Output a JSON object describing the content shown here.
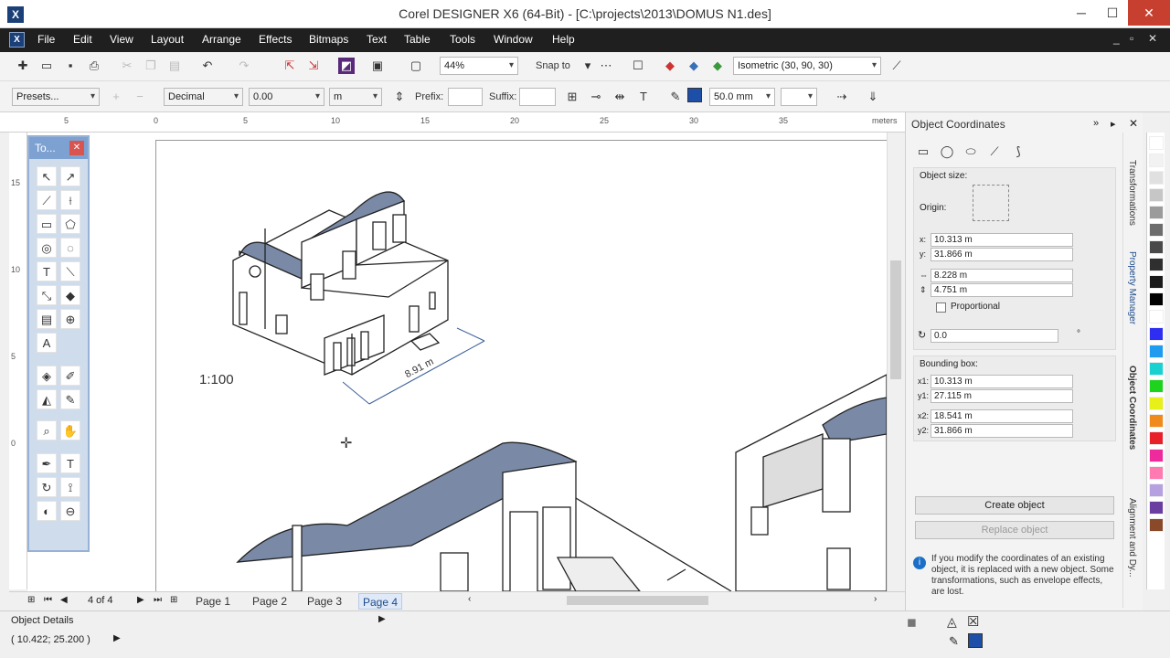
{
  "window": {
    "title": "Corel DESIGNER X6 (64-Bit) - [C:\\projects\\2013\\DOMUS N1.des]",
    "app_icon": "X",
    "minimize": "─",
    "maximize": "☐",
    "close": "✕"
  },
  "menu": {
    "items": [
      "File",
      "Edit",
      "View",
      "Layout",
      "Arrange",
      "Effects",
      "Bitmaps",
      "Text",
      "Table",
      "Tools",
      "Window",
      "Help"
    ],
    "right_controls": [
      "_",
      "▫",
      "✕"
    ]
  },
  "toolbar1": {
    "zoom": "44%",
    "snap_to": "Snap to",
    "view": "Isometric (30, 90, 30)"
  },
  "toolbar2": {
    "presets": "Presets...",
    "units_style": "Decimal",
    "precision": "0.00",
    "units": "m",
    "prefix_label": "Prefix:",
    "prefix_value": "",
    "suffix_label": "Suffix:",
    "suffix_value": "",
    "outline_width": "50.0 mm"
  },
  "ruler": {
    "h_ticks": [
      "5",
      "0",
      "5",
      "10",
      "15",
      "20",
      "25",
      "30",
      "35"
    ],
    "unit": "meters",
    "v_ticks": [
      "15",
      "10",
      "5",
      "0"
    ]
  },
  "toolbox": {
    "title": "To...",
    "close": "✕"
  },
  "drawing": {
    "scale_label": "1:100",
    "dimension_label": "8.91 m"
  },
  "pagebar": {
    "page_count": "4 of 4",
    "tabs": [
      "Page 1",
      "Page 2",
      "Page 3",
      "Page 4"
    ],
    "active_tab": "Page 4"
  },
  "status": {
    "object_details": "Object Details",
    "coords": "( 10.422; 25.200 )"
  },
  "docker": {
    "title": "Object Coordinates",
    "object_size_label": "Object size:",
    "origin_label": "Origin:",
    "x": "10.313 m",
    "y": "31.866 m",
    "width": "8.228 m",
    "height": "4.751 m",
    "proportional_label": "Proportional",
    "rotation": "0.0",
    "rotation_unit": "°",
    "bounding_box_label": "Bounding box:",
    "x1": "10.313 m",
    "y1": "27.115 m",
    "x2": "18.541 m",
    "y2": "31.866 m",
    "create_button": "Create object",
    "replace_button": "Replace object",
    "info_text": "If you modify the coordinates of an existing object, it is replaced with a new object.  Some transformations, such as envelope effects, are lost.",
    "labels": {
      "x": "x:",
      "y": "y:",
      "x1": "x1:",
      "y1": "y1:",
      "x2": "x2:",
      "y2": "y2:"
    }
  },
  "side_tabs": [
    "Transformations",
    "Property Manager",
    "Object Coordinates",
    "Alignment and Dy..."
  ],
  "palette": {
    "colors": [
      "#ffffff",
      "#f2f2f2",
      "#e0e0e0",
      "#c6c6c6",
      "#9b9b9b",
      "#6d6d6d",
      "#4a4a4a",
      "#2f2f2f",
      "#1a1a1a",
      "#000000",
      "#ffffff",
      "#2e2ef2",
      "#1f9cf0",
      "#18d1d1",
      "#1ed31e",
      "#e8f01a",
      "#f08a1a",
      "#e8202a",
      "#ee2a9c",
      "#ff7ab0",
      "#b5a0e0",
      "#6a3da0",
      "#8a4a2a"
    ]
  },
  "accent_color": "#1c4b8c",
  "roof_color": "#7a8aa6"
}
